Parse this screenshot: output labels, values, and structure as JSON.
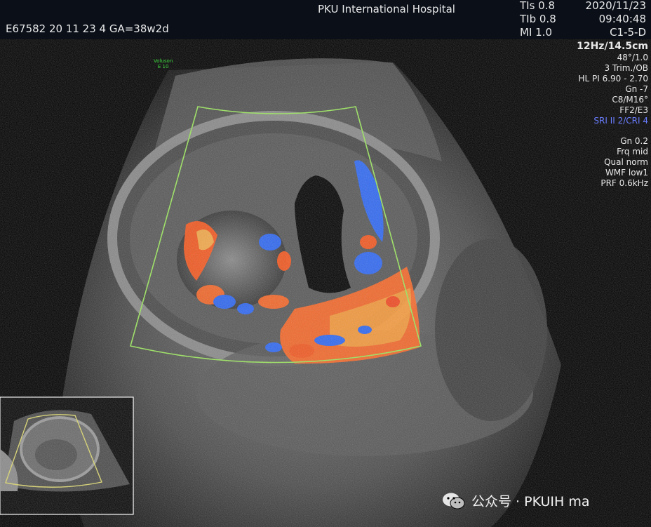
{
  "header": {
    "hospital": "PKU International Hospital",
    "patient_line": "E67582 20 11 23 4  GA=38w2d",
    "tis": "TIs  0.8",
    "tib": "TIb  0.8",
    "mi": "MI  1.0",
    "date": "2020/11/23",
    "time": "09:40:48",
    "probe": "C1-5-D"
  },
  "overlay": {
    "voluson_line1": "Voluson",
    "voluson_line2": "E 10"
  },
  "params": {
    "depth": "12Hz/14.5cm",
    "items": [
      "48°/1.0",
      "3 Trim./OB",
      "HL PI 6.90 - 2.70",
      "Gn  -7",
      "C8/M16°",
      "FF2/E3"
    ],
    "sri": "SRI II 2/CRI 4",
    "color_items": [
      "Gn  0.2",
      "Frq mid",
      "Qual norm",
      "WMF low1",
      "PRF  0.6kHz"
    ]
  },
  "watermark": {
    "text": "公众号 · PKUIH ma"
  },
  "colors": {
    "roi_box": "#9fe06a",
    "thumb_box": "#d6d27a",
    "doppler_red": "#ff5a1e",
    "doppler_blue": "#2e6bff",
    "sri_text": "#6a7dff"
  }
}
